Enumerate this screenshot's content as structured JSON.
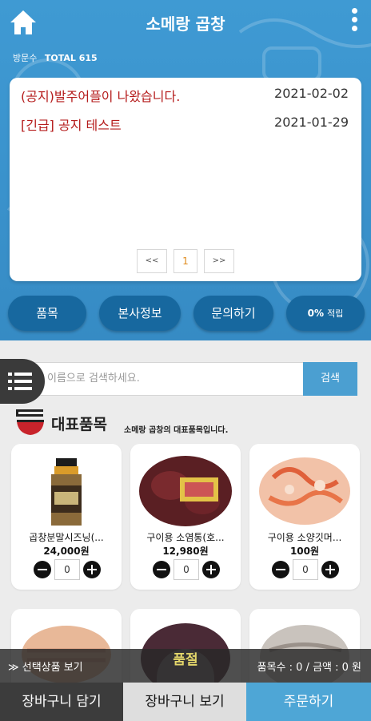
{
  "header": {
    "title": "소메랑 곱창",
    "visitors_label": "방문수",
    "visitors_total": "TOTAL 615"
  },
  "notices": [
    {
      "title": "(공지)발주어플이 나왔습니다.",
      "date": "2021-02-02"
    },
    {
      "title": "[긴급] 공지 테스트",
      "date": "2021-01-29"
    }
  ],
  "pagination": {
    "prev": "<<",
    "current": "1",
    "next": ">>"
  },
  "menu": {
    "products": "품목",
    "company_info": "본사정보",
    "inquiry": "문의하기",
    "points_value": "0%",
    "points_label": "적립"
  },
  "search": {
    "placeholder": "이름으로 검색하세요.",
    "button": "검색"
  },
  "section": {
    "title": "대표품목",
    "subtitle": "소메랑 곱창의 대표품목입니다."
  },
  "products": [
    {
      "name": "곱창분말시즈닝(...",
      "price": "24,000원",
      "qty": "0"
    },
    {
      "name": "구이용 소염통(호...",
      "price": "12,980원",
      "qty": "0"
    },
    {
      "name": "구이용 소양깃머...",
      "price": "100원",
      "qty": "0"
    }
  ],
  "soldout_label": "품절",
  "bottom": {
    "selected_toggle": "≫ 선택상품 보기",
    "summary": "품목수 : 0 / 금액 : 0 원",
    "add_cart": "장바구니 담기",
    "view_cart": "장바구니 보기",
    "order": "주문하기"
  },
  "colors": {
    "header_blue": "#3a92cc",
    "button_navy": "#17689f",
    "notice_red": "#b51b1b",
    "order_blue": "#4ea6d6"
  },
  "icons": [
    "home-icon",
    "more-vertical-icon",
    "list-icon",
    "bowl-icon",
    "minus-icon",
    "plus-icon"
  ]
}
